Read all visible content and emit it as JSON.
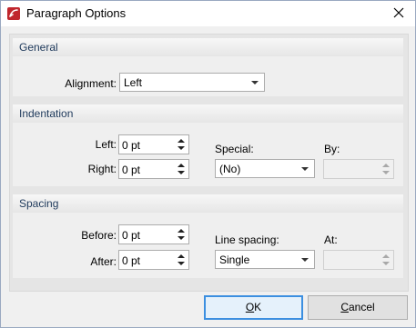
{
  "window": {
    "title": "Paragraph Options",
    "app_icon": "pdf-editor-icon",
    "close_icon": "close-icon"
  },
  "general": {
    "header": "General",
    "alignment_label": "Alignment:",
    "alignment_value": "Left"
  },
  "indentation": {
    "header": "Indentation",
    "left_label": "Left:",
    "left_value": "0 pt",
    "right_label": "Right:",
    "right_value": "0 pt",
    "special_label": "Special:",
    "special_value": "(No)",
    "by_label": "By:",
    "by_value": ""
  },
  "spacing": {
    "header": "Spacing",
    "before_label": "Before:",
    "before_value": "0 pt",
    "after_label": "After:",
    "after_value": "0 pt",
    "line_spacing_label": "Line spacing:",
    "line_spacing_value": "Single",
    "at_label": "At:",
    "at_value": ""
  },
  "buttons": {
    "ok_access": "O",
    "ok_rest": "K",
    "cancel_access": "C",
    "cancel_rest": "ancel"
  },
  "colors": {
    "group_title": "#1e395b",
    "default_button_border": "#3c8fe0",
    "app_icon_red": "#c0272d"
  }
}
